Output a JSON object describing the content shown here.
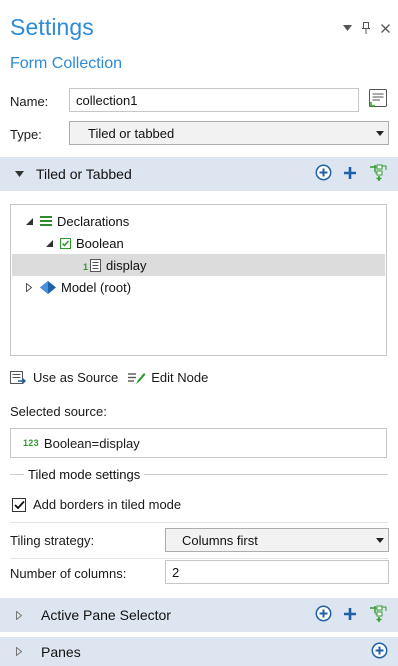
{
  "panel": {
    "title": "Settings",
    "subtitle": "Form Collection"
  },
  "form": {
    "name_label": "Name:",
    "name_value": "collection1",
    "type_label": "Type:",
    "type_value": "Tiled or tabbed"
  },
  "section_tiled": {
    "title": "Tiled or Tabbed"
  },
  "tree": {
    "items": [
      {
        "label": "Declarations",
        "icon": "declarations-icon",
        "expanded": true
      },
      {
        "label": "Boolean",
        "icon": "boolean-icon",
        "expanded": true
      },
      {
        "label": "display",
        "icon": "variable-icon",
        "selected": true
      },
      {
        "label": "Model (root)",
        "icon": "model-icon",
        "expanded": false
      }
    ]
  },
  "tools": {
    "use_as_source": "Use as Source",
    "edit_node": "Edit Node"
  },
  "source": {
    "label": "Selected source:",
    "badge": "123",
    "value": "Boolean=display"
  },
  "tiled_settings": {
    "group_label": "Tiled mode settings",
    "borders_label": "Add borders in tiled mode",
    "borders_checked": true,
    "tiling_label": "Tiling strategy:",
    "tiling_value": "Columns first",
    "columns_label": "Number of columns:",
    "columns_value": "2"
  },
  "section_active": {
    "title": "Active Pane Selector"
  },
  "section_panes": {
    "title": "Panes"
  },
  "colors": {
    "accent": "#2e8bd6",
    "section_bg": "#dde6f0",
    "selection": "#dcdcdc",
    "green": "#2f9a2f"
  }
}
